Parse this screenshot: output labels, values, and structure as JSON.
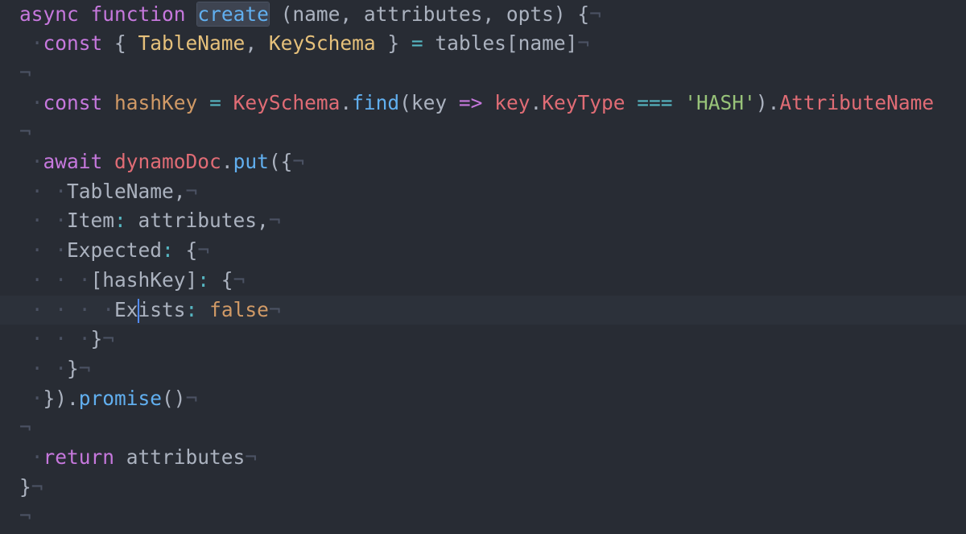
{
  "editor": {
    "eol_marker": "¬",
    "indent_marker": "·",
    "active_line": 10,
    "lines": [
      {
        "tokens": [
          {
            "text": "async",
            "type": "keyword"
          },
          {
            "text": " ",
            "type": "param"
          },
          {
            "text": "function",
            "type": "keyword"
          },
          {
            "text": " ",
            "type": "param"
          },
          {
            "text": "create",
            "type": "function-name",
            "selected": true
          },
          {
            "text": " (name, attributes, opts) {",
            "type": "param"
          }
        ]
      },
      {
        "indent": 1,
        "tokens": [
          {
            "text": "const",
            "type": "keyword"
          },
          {
            "text": " { ",
            "type": "punct"
          },
          {
            "text": "TableName",
            "type": "class"
          },
          {
            "text": ", ",
            "type": "punct"
          },
          {
            "text": "KeySchema",
            "type": "class"
          },
          {
            "text": " } ",
            "type": "punct"
          },
          {
            "text": "=",
            "type": "operator"
          },
          {
            "text": " tables[name]",
            "type": "param"
          }
        ]
      },
      {
        "tokens": []
      },
      {
        "indent": 1,
        "tokens": [
          {
            "text": "const",
            "type": "keyword"
          },
          {
            "text": " ",
            "type": "param"
          },
          {
            "text": "hashKey",
            "type": "boolean"
          },
          {
            "text": " ",
            "type": "param"
          },
          {
            "text": "=",
            "type": "operator"
          },
          {
            "text": " ",
            "type": "param"
          },
          {
            "text": "KeySchema",
            "type": "variable"
          },
          {
            "text": ".",
            "type": "punct"
          },
          {
            "text": "find",
            "type": "method"
          },
          {
            "text": "(key ",
            "type": "param"
          },
          {
            "text": "=>",
            "type": "keyword"
          },
          {
            "text": " ",
            "type": "param"
          },
          {
            "text": "key",
            "type": "variable"
          },
          {
            "text": ".",
            "type": "punct"
          },
          {
            "text": "KeyType",
            "type": "property"
          },
          {
            "text": " ",
            "type": "param"
          },
          {
            "text": "===",
            "type": "operator"
          },
          {
            "text": " ",
            "type": "param"
          },
          {
            "text": "'HASH'",
            "type": "string"
          },
          {
            "text": ").",
            "type": "punct"
          },
          {
            "text": "AttributeName",
            "type": "property"
          }
        ],
        "no_eol": true
      },
      {
        "tokens": []
      },
      {
        "indent": 1,
        "tokens": [
          {
            "text": "await",
            "type": "keyword"
          },
          {
            "text": " ",
            "type": "param"
          },
          {
            "text": "dynamoDoc",
            "type": "variable"
          },
          {
            "text": ".",
            "type": "punct"
          },
          {
            "text": "put",
            "type": "method"
          },
          {
            "text": "({",
            "type": "punct"
          }
        ]
      },
      {
        "indent": 2,
        "tokens": [
          {
            "text": "TableName,",
            "type": "param"
          }
        ]
      },
      {
        "indent": 2,
        "tokens": [
          {
            "text": "Item",
            "type": "object-key"
          },
          {
            "text": ":",
            "type": "operator"
          },
          {
            "text": " attributes,",
            "type": "param"
          }
        ]
      },
      {
        "indent": 2,
        "tokens": [
          {
            "text": "Expected",
            "type": "object-key"
          },
          {
            "text": ":",
            "type": "operator"
          },
          {
            "text": " {",
            "type": "punct"
          }
        ]
      },
      {
        "indent": 3,
        "tokens": [
          {
            "text": "[hashKey]",
            "type": "param"
          },
          {
            "text": ":",
            "type": "operator"
          },
          {
            "text": " {",
            "type": "punct"
          }
        ]
      },
      {
        "indent": 4,
        "tokens": [
          {
            "text": "Ex",
            "type": "object-key"
          },
          {
            "cursor": true
          },
          {
            "text": "ists",
            "type": "object-key"
          },
          {
            "text": ":",
            "type": "operator"
          },
          {
            "text": " ",
            "type": "param"
          },
          {
            "text": "false",
            "type": "boolean"
          }
        ]
      },
      {
        "indent": 3,
        "tokens": [
          {
            "text": "}",
            "type": "punct"
          }
        ]
      },
      {
        "indent": 2,
        "tokens": [
          {
            "text": "}",
            "type": "punct"
          }
        ]
      },
      {
        "indent": 1,
        "tokens": [
          {
            "text": "}).",
            "type": "punct"
          },
          {
            "text": "promise",
            "type": "method"
          },
          {
            "text": "()",
            "type": "punct"
          }
        ]
      },
      {
        "tokens": []
      },
      {
        "indent": 1,
        "tokens": [
          {
            "text": "return",
            "type": "keyword"
          },
          {
            "text": " attributes",
            "type": "param"
          }
        ]
      },
      {
        "tokens": [
          {
            "text": "}",
            "type": "punct"
          }
        ]
      },
      {
        "tokens": []
      }
    ]
  }
}
